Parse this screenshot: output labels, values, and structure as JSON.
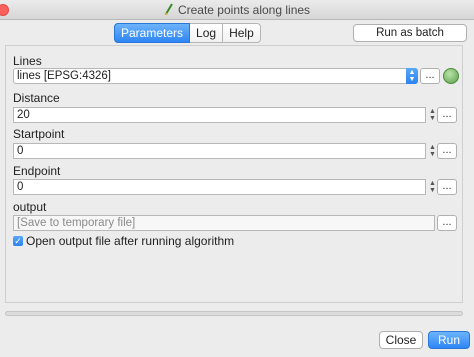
{
  "window": {
    "title": "Create points along lines"
  },
  "tabs": [
    {
      "label": "Parameters",
      "active": true
    },
    {
      "label": "Log",
      "active": false
    },
    {
      "label": "Help",
      "active": false
    }
  ],
  "batch_button": "Run as batch process...",
  "params": {
    "lines": {
      "label": "Lines",
      "value": "lines [EPSG:4326]"
    },
    "distance": {
      "label": "Distance",
      "value": "20"
    },
    "startpoint": {
      "label": "Startpoint",
      "value": "0"
    },
    "endpoint": {
      "label": "Endpoint",
      "value": "0"
    },
    "output": {
      "label": "output",
      "placeholder": "[Save to temporary file]"
    },
    "open_output": {
      "label": "Open output file after running algorithm",
      "checked": true
    }
  },
  "browse_label": "...",
  "buttons": {
    "close": "Close",
    "run": "Run"
  },
  "colors": {
    "accent": "#2e86f5",
    "close_light": "#fc605c",
    "iterate_icon": "#5aa04a"
  },
  "icons": {
    "title": "processing-brush-icon",
    "iterate": "iterate-icon"
  }
}
